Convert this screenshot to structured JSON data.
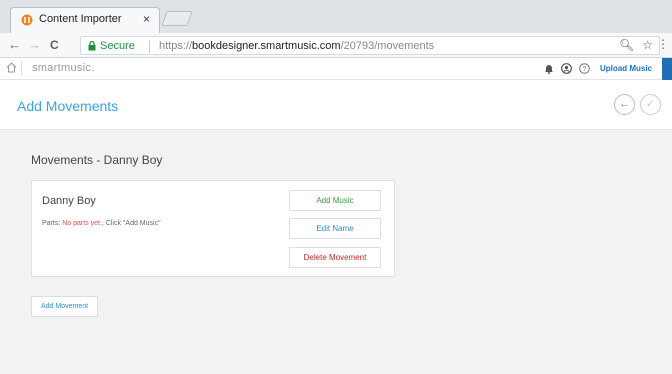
{
  "browser": {
    "tab_title": "Content Importer",
    "tab_close": "×",
    "nav_back": "←",
    "nav_forward": "→",
    "nav_reload": "C",
    "secure_label": "Secure",
    "url_scheme": "https://",
    "url_host": "bookdesigner.smartmusic.com",
    "url_path": "/20793/movements",
    "menu_dots": "⋮"
  },
  "app": {
    "logo_text": "smartmusic.",
    "upload_label": "Upload Music"
  },
  "page": {
    "title": "Add Movements",
    "back_glyph": "←",
    "done_glyph": "✓"
  },
  "movements": {
    "heading": "Movements - Danny Boy",
    "card": {
      "name": "Danny Boy",
      "parts_prefix": "Parts: ",
      "parts_none": "No parts yet.",
      "parts_suffix": ", Click \"Add Music\"",
      "add_music_label": "Add Music",
      "edit_name_label": "Edit Name",
      "delete_label": "Delete Movement"
    },
    "add_movement_label": "Add Movement"
  },
  "colors": {
    "accent_blue": "#35a7dd",
    "secure_green": "#1e8e3e",
    "add_green": "#3c9a44",
    "delete_red": "#c62828"
  }
}
